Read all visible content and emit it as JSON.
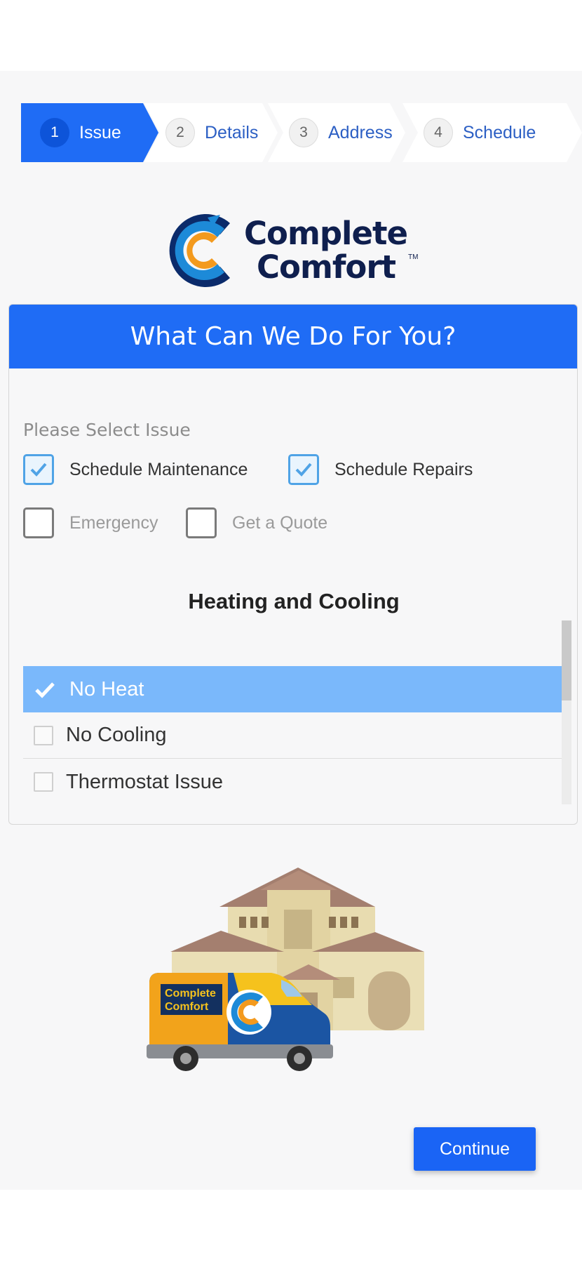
{
  "stepper": {
    "steps": [
      {
        "number": "1",
        "label": "Issue",
        "state": "active"
      },
      {
        "number": "2",
        "label": "Details",
        "state": "idle"
      },
      {
        "number": "3",
        "label": "Address",
        "state": "idle"
      },
      {
        "number": "4",
        "label": "Schedule",
        "state": "idle"
      }
    ]
  },
  "logo": {
    "line1": "Complete",
    "line2": "Comfort",
    "tm": "TM"
  },
  "card": {
    "header": "What Can We Do For You?",
    "section_label": "Please Select Issue",
    "options": [
      {
        "label": "Schedule Maintenance",
        "checked": true
      },
      {
        "label": "Schedule Repairs",
        "checked": true
      },
      {
        "label": "Emergency",
        "checked": false
      },
      {
        "label": "Get a Quote",
        "checked": false
      }
    ],
    "category_title": "Heating and Cooling",
    "issues": [
      {
        "label": "No Heat",
        "selected": true
      },
      {
        "label": "No Cooling",
        "selected": false
      },
      {
        "label": "Thermostat Issue",
        "selected": false
      }
    ]
  },
  "van": {
    "brand_line1": "Complete",
    "brand_line2": "Comfort"
  },
  "actions": {
    "continue_label": "Continue"
  },
  "colors": {
    "primary": "#1f6cf5",
    "selected_row": "#7ab8fb",
    "check_accent": "#4fa3e6",
    "house": "#e8dcb0",
    "roof": "#a47f6f"
  }
}
